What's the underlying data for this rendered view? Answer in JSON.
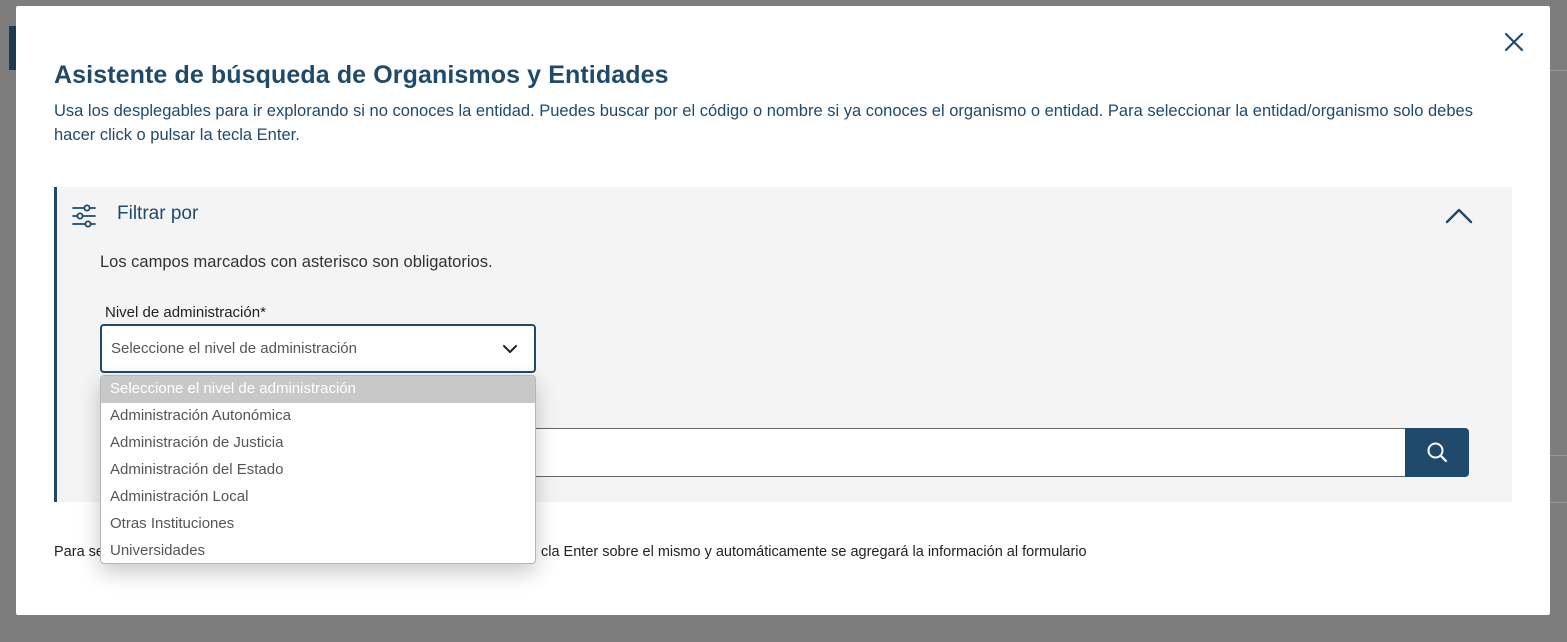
{
  "modal": {
    "title": "Asistente de búsqueda de Organismos y Entidades",
    "description": "Usa los desplegables para ir explorando si no conoces la entidad. Puedes buscar por el código o nombre si ya conoces el organismo o entidad. Para seleccionar la entidad/organismo solo debes hacer click o pulsar la tecla Enter.",
    "close_icon": "close-icon"
  },
  "filter": {
    "title": "Filtrar por",
    "icon": "sliders-icon",
    "toggle_icon": "chevron-up-icon",
    "required_note": "Los campos marcados con asterisco son obligatorios.",
    "level_field": {
      "label": "Nivel de administración*",
      "selected_value": "Seleccione el nivel de administración",
      "options": [
        "Seleccione el nivel de administración",
        "Administración Autonómica",
        "Administración de Justicia",
        "Administración del Estado",
        "Administración Local",
        "Otras Instituciones",
        "Universidades"
      ],
      "highlighted_index": 0
    },
    "search": {
      "value": "",
      "button_icon": "search-icon"
    }
  },
  "footer": {
    "note_left": "Para se",
    "note_right": "cla Enter sobre el mismo y automáticamente se agregará la información al formulario"
  },
  "colors": {
    "primary": "#1f4a6b",
    "panel_bg": "#f4f4f4",
    "overlay": "#7d7d7d",
    "option_highlight": "#c8c8c8"
  }
}
